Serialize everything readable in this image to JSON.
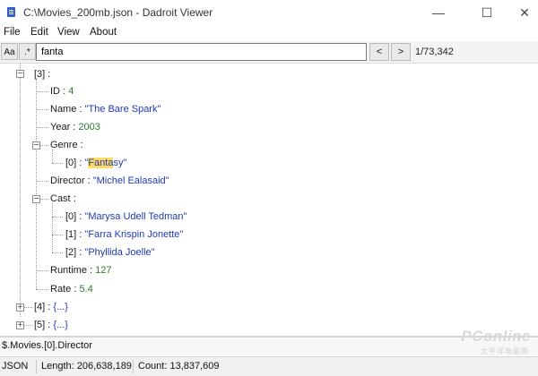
{
  "window": {
    "title": "C:\\Movies_200mb.json - Dadroit Viewer",
    "app_icon": "document-icon",
    "controls": [
      "minimize-icon",
      "maximize-icon",
      "close-icon"
    ]
  },
  "menu": {
    "items": [
      "File",
      "Edit",
      "View",
      "About"
    ]
  },
  "search": {
    "match_case_label": "Aa",
    "regex_label": ".*",
    "query": "fanta",
    "prev_label": "<",
    "next_label": ">",
    "result_count": "1/73,342"
  },
  "tree": {
    "record_3_key": "[3]",
    "colon": ":",
    "id": {
      "key": "ID",
      "value": "4"
    },
    "name": {
      "key": "Name",
      "value": "\"The Bare Spark\""
    },
    "year": {
      "key": "Year",
      "value": "2003"
    },
    "genre": {
      "key": "Genre",
      "item0_key": "[0]",
      "item0_before": "\"",
      "item0_highlight": "Fanta",
      "item0_after": "sy\""
    },
    "director": {
      "key": "Director",
      "value": "\"Michel Ealasaid\""
    },
    "cast": {
      "key": "Cast",
      "items": [
        {
          "key": "[0]",
          "value": "\"Marysa Udell Tedman\""
        },
        {
          "key": "[1]",
          "value": "\"Farra Krispin Jonette\""
        },
        {
          "key": "[2]",
          "value": "\"Phyllida Joelle\""
        }
      ]
    },
    "runtime": {
      "key": "Runtime",
      "value": "127"
    },
    "rate": {
      "key": "Rate",
      "value": "5.4"
    },
    "record_4_key": "[4]",
    "record_5_key": "[5]",
    "collapsed": "{...}"
  },
  "path": "$.Movies.[0].Director",
  "status": {
    "format": "JSON",
    "length": "Length: 206,638,189",
    "count": "Count: 13,837,609"
  },
  "watermark": {
    "brand": "PConline",
    "sub": "太平洋电脑网"
  },
  "colors": {
    "highlight": "#ffd966",
    "string": "#1c3ab8",
    "number": "#2b7a2b"
  }
}
